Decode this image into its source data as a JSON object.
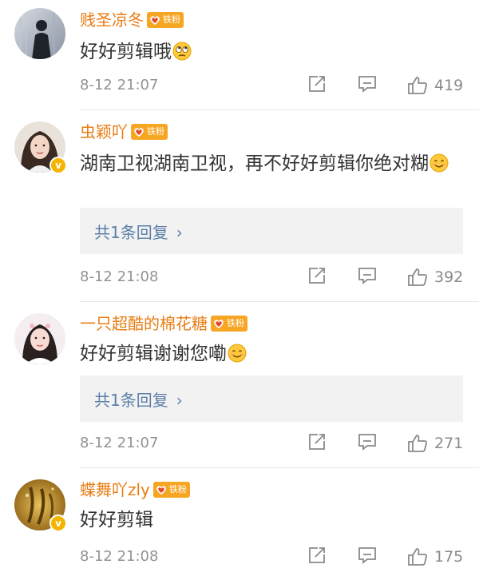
{
  "comments": [
    {
      "username": "贱圣凉冬",
      "badge_text": "铁粉",
      "content": "好好剪辑哦",
      "emoji_after": "eye-roll-emoji",
      "timestamp": "8-12 21:07",
      "likes": "419",
      "verified": false,
      "reply_label": ""
    },
    {
      "username": "虫颖吖",
      "badge_text": "铁粉",
      "content": "湖南卫视湖南卫视，再不好好剪辑你绝对糊",
      "emoji_after": "smile-emoji",
      "timestamp": "8-12 21:08",
      "likes": "392",
      "verified": true,
      "reply_label": "共1条回复"
    },
    {
      "username": "一只超酷的棉花糖",
      "badge_text": "铁粉",
      "content": "好好剪辑谢谢您嘞",
      "emoji_after": "smile-emoji",
      "timestamp": "8-12 21:07",
      "likes": "271",
      "verified": false,
      "reply_label": "共1条回复"
    },
    {
      "username": "蝶舞吖zly",
      "badge_text": "铁粉",
      "content": "好好剪辑",
      "emoji_after": "",
      "timestamp": "8-12 21:08",
      "likes": "175",
      "verified": true,
      "reply_label": ""
    }
  ],
  "colors": {
    "username": "#e87d15",
    "badge": "#f6a623",
    "reply_link": "#5b7ea8",
    "meta": "#939393",
    "reply_bg": "#f2f2f2"
  },
  "icons": {
    "reply_chevron": "›",
    "verified_mark": "v"
  }
}
